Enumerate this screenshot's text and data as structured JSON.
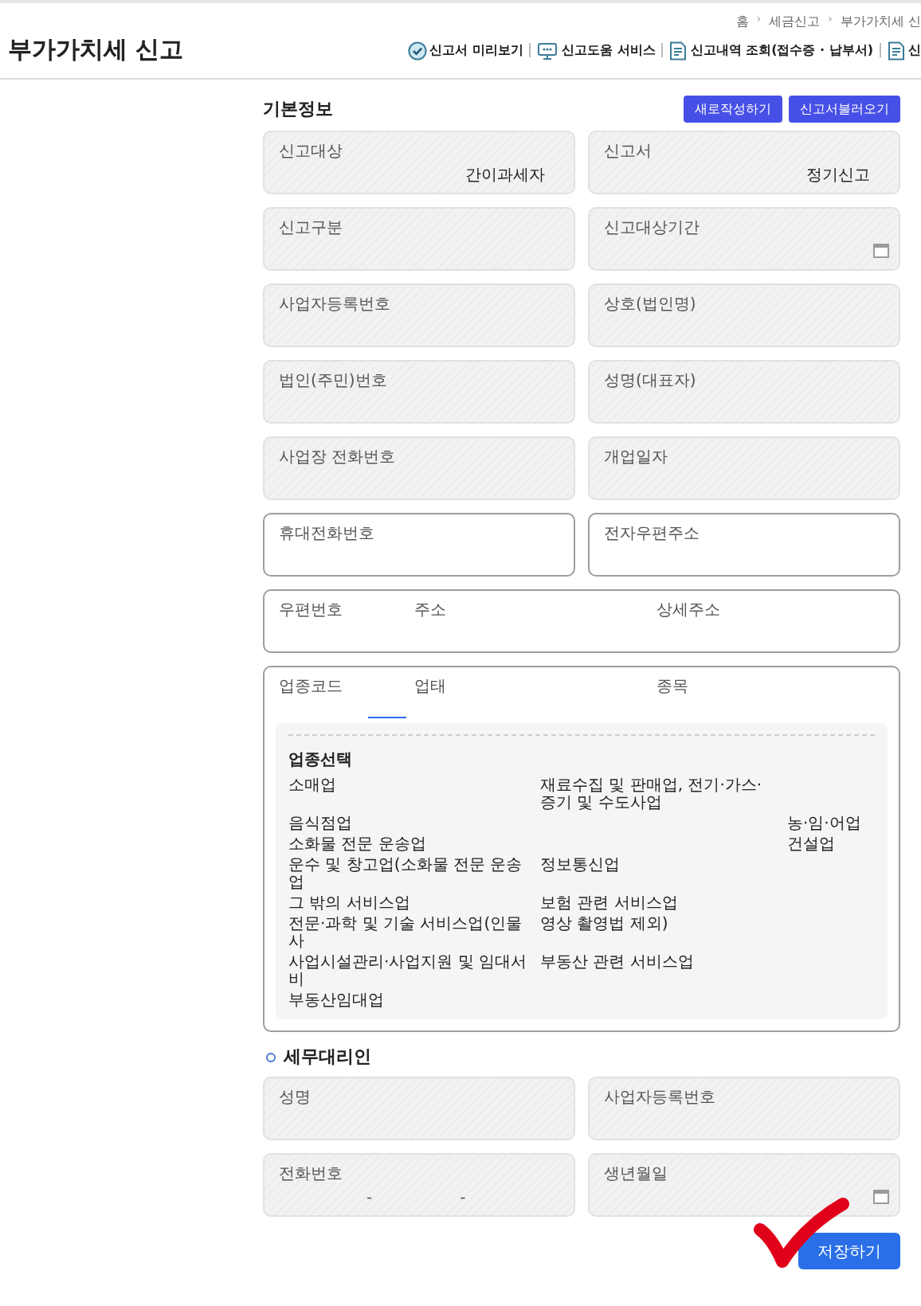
{
  "breadcrumb": [
    {
      "kind": "link",
      "text": "홈"
    },
    {
      "kind": "separator",
      "text": "›"
    },
    {
      "kind": "link",
      "text": "세금신고"
    },
    {
      "kind": "separator",
      "text": "›"
    },
    {
      "kind": "link",
      "text": "부가가치세 신"
    }
  ],
  "page_title": "부가가치세 신고",
  "header_links": [
    "신고서 미리보기",
    "신고도움 서비스",
    "신고내역 조회(접수증 · 납부서)",
    "신"
  ],
  "basic_info": {
    "title": "기본정보",
    "buttons": [
      "새로작성하기",
      "신고서불러오기"
    ],
    "fields": [
      {
        "label": "신고대상",
        "value": "간이과세자",
        "kind": "readonly"
      },
      {
        "label": "신고서",
        "value": "정기신고",
        "kind": "readonly"
      },
      {
        "label": "신고구분",
        "kind": "readonly"
      },
      {
        "label": "신고대상기간",
        "kind": "readonly",
        "calendar": true
      },
      {
        "label": "사업자등록번호",
        "kind": "readonly"
      },
      {
        "label": "상호(법인명)",
        "kind": "readonly"
      },
      {
        "label": "법인(주민)번호",
        "kind": "readonly"
      },
      {
        "label": "성명(대표자)",
        "kind": "readonly"
      },
      {
        "label": "사업장 전화번호",
        "kind": "readonly"
      },
      {
        "label": "개업일자",
        "kind": "readonly"
      },
      {
        "label": "휴대전화번호",
        "kind": "editable"
      },
      {
        "label": "전자우편주소",
        "kind": "editable"
      }
    ],
    "address_labels": [
      "우편번호",
      "주소",
      "상세주소"
    ],
    "industry": {
      "tabs": [
        "업종코드",
        "업태",
        "종목"
      ],
      "panel_title": "업종선택",
      "options": [
        {
          "column_1": "소매업",
          "column_2": "재료수집 및 판매업, 전기·가스·증기 및 수도사업"
        },
        {
          "column_1": "음식점업",
          "column_3": "농·임·어업"
        },
        {
          "column_1": "소화물 전문 운송업",
          "column_3": "건설업"
        },
        {
          "column_1": "운수 및 창고업(소화물 전문 운송업",
          "column_2": "정보통신업"
        },
        {
          "column_1": "그 밖의 서비스업",
          "column_2": "보험 관련 서비스업"
        },
        {
          "column_1": "전문·과학 및 기술 서비스업(인물사",
          "column_2": "영상 촬영법 제외)"
        },
        {
          "column_1": "사업시설관리·사업지원 및 임대서비",
          "column_2": "부동산 관련 서비스업"
        },
        {
          "column_1": "부동산임대업"
        }
      ]
    }
  },
  "tax_agent": {
    "title": "세무대리인",
    "fields": [
      {
        "label": "성명",
        "kind": "readonly"
      },
      {
        "label": "사업자등록번호",
        "kind": "readonly"
      },
      {
        "label": "전화번호",
        "kind": "readonly",
        "separators": [
          "-",
          "-"
        ]
      },
      {
        "label": "생년월일",
        "kind": "readonly",
        "calendar": true
      }
    ]
  },
  "save_button": "저장하기"
}
